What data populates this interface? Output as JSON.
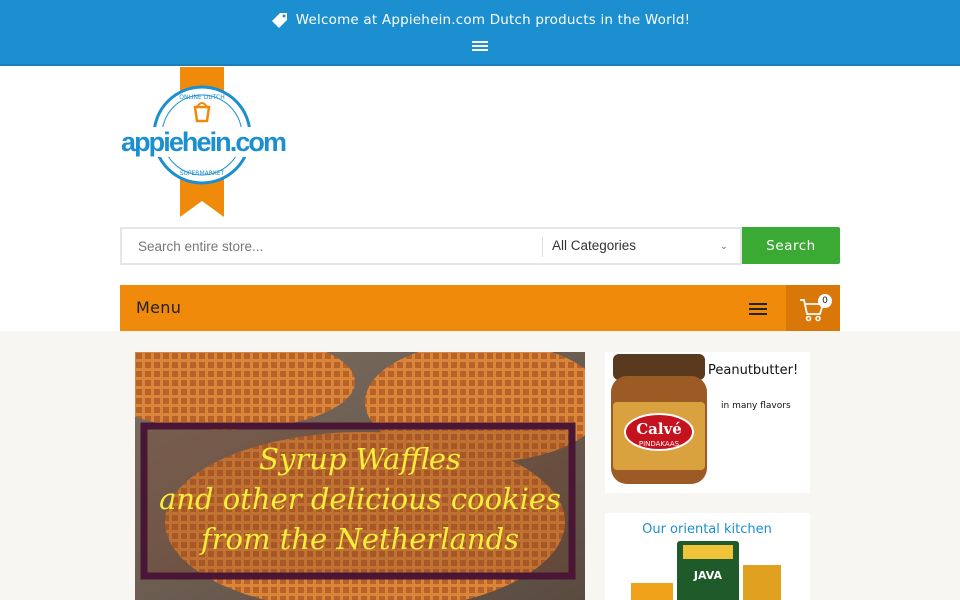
{
  "topbar": {
    "welcome": "Welcome at Appiehein.com Dutch products in the World!"
  },
  "logo": {
    "name": "appiehein.com",
    "ring_top": "ONLINE DUTCH",
    "ring_bottom": "SUPERMARKET"
  },
  "search": {
    "placeholder": "Search entire store...",
    "category": "All Categories",
    "button": "Search"
  },
  "menu": {
    "label": "Menu",
    "cart_count": "0"
  },
  "banner": {
    "line1": "Syrup Waffles",
    "line2": "and other delicious cookies",
    "line3": "from the Netherlands"
  },
  "promo_peanut": {
    "title": "Peanutbutter!",
    "subtitle": "in many flavors",
    "jar_brand": "Calvé",
    "jar_product": "PINDAKAAS"
  },
  "promo_oriental": {
    "title": "Our oriental kitchen",
    "pack_label": "JAVA"
  },
  "colors": {
    "topbar": "#1b8fd0",
    "menubar": "#f08a0a",
    "search_button": "#3aaa35"
  }
}
